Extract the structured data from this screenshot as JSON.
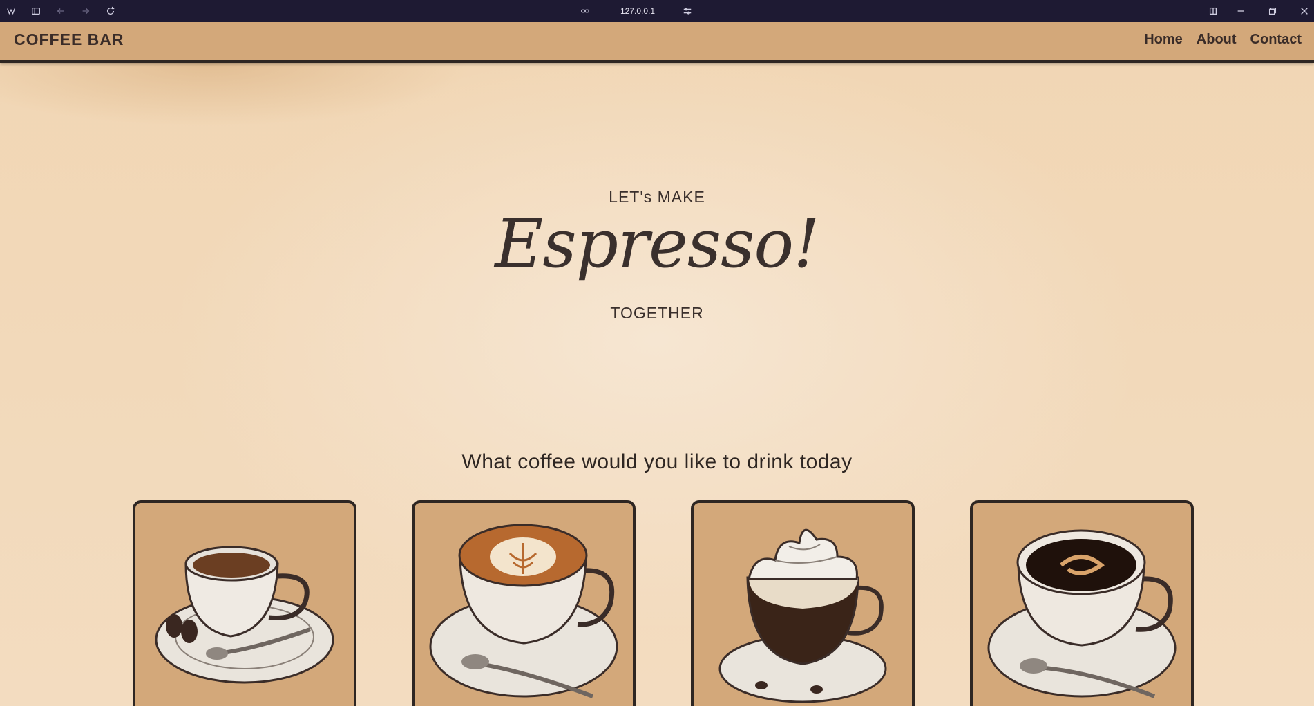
{
  "browser": {
    "url": "127.0.0.1"
  },
  "navbar": {
    "brand": "COFFEE BAR",
    "links": [
      {
        "label": "Home"
      },
      {
        "label": "About"
      },
      {
        "label": "Contact"
      }
    ]
  },
  "hero": {
    "top_line": "LET's MAKE",
    "script_word": "Espresso!",
    "bottom_line": "TOGETHER"
  },
  "menu": {
    "title": "What coffee would you like to drink today",
    "cards": [
      {
        "icon": "espresso-cup-icon"
      },
      {
        "icon": "latte-cup-icon"
      },
      {
        "icon": "whipped-cream-coffee-icon"
      },
      {
        "icon": "americano-cup-icon"
      }
    ]
  },
  "colors": {
    "navbar": "#d3a87a",
    "card": "#d3a87a",
    "text": "#3a2c28",
    "chrome": "#1e1a33"
  }
}
